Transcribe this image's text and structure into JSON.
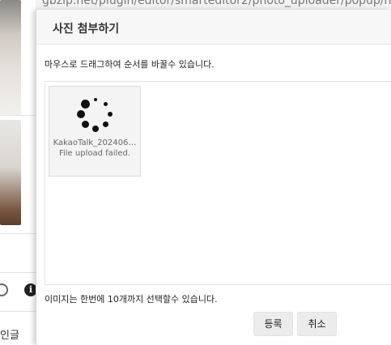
{
  "browser": {
    "url": "gbzip.net/plugin/editor/smarteditor2/photo_uploader/popup/ht"
  },
  "background_page": {
    "info_icon_glyph": "i",
    "bottom_text": "인글"
  },
  "popup": {
    "title": "사진 첨부하기",
    "instruction": "마우스로 드래그하여 순서를 바꿀수 있습니다.",
    "files": [
      {
        "name": "KakaoTalk_202406…",
        "status": "File upload failed.",
        "state": "loading"
      }
    ],
    "limit_note": "이미지는 한번에 10개까지 선택할수 있습니다.",
    "buttons": {
      "submit": "등록",
      "cancel": "취소"
    }
  }
}
